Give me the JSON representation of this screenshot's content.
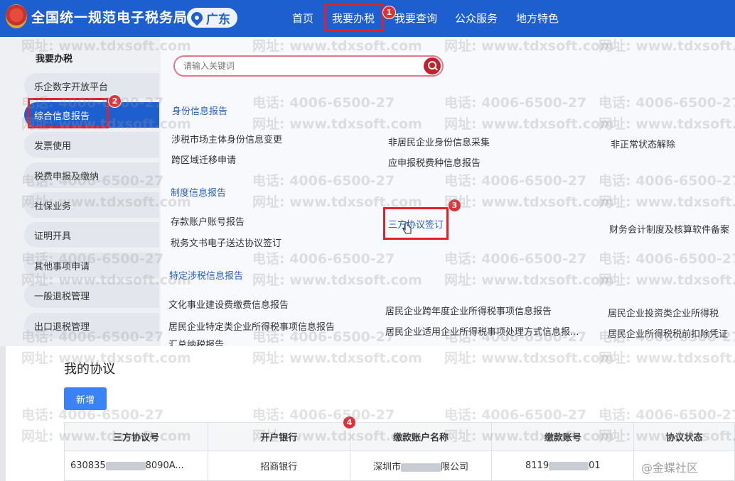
{
  "header": {
    "site_title": "全国统一规范电子税务局",
    "region": "广东",
    "nav": [
      "首页",
      "我要办税",
      "我要查询",
      "公众服务",
      "地方特色"
    ]
  },
  "sidebar": {
    "heading": "我要办税",
    "items": [
      "乐企数字开放平台",
      "综合信息报告",
      "发票使用",
      "税费申报及缴纳",
      "社保业务",
      "证明开具",
      "其他事项申请",
      "一般退税管理",
      "出口退税管理"
    ]
  },
  "search": {
    "placeholder": "请输入关键词"
  },
  "sections": {
    "identity": {
      "title": "身份信息报告",
      "links": [
        "涉税市场主体身份信息变更",
        "跨区域迁移申请",
        "非居民企业身份信息采集",
        "应申报税费种信息报告",
        "非正常状态解除"
      ]
    },
    "system": {
      "title": "制度信息报告",
      "links": [
        "存款账户账号报告",
        "税务文书电子送达协议签订",
        "三方协议签订",
        "财务会计制度及核算软件备案"
      ]
    },
    "specific": {
      "title": "特定涉税信息报告",
      "links": [
        "文化事业建设费缴费信息报告",
        "居民企业特定类企业所得税事项信息报告",
        "汇总纳税报告",
        "居民企业跨年度企业所得税事项信息报告",
        "居民企业适用企业所得税事项处理方式信息报...",
        "居民企业投资类企业所得税",
        "居民企业所得税税前扣除凭证"
      ]
    }
  },
  "markers": [
    "1",
    "2",
    "3",
    "4"
  ],
  "agreements": {
    "title": "我的协议",
    "add_label": "新增",
    "columns": [
      "三方协议号",
      "开户银行",
      "缴款账户名称",
      "缴款账号",
      "协议状态"
    ],
    "row": {
      "agreement_no_prefix": "630835",
      "agreement_no_suffix": "8090A...",
      "bank": "招商银行",
      "account_name_prefix": "深圳市",
      "account_name_suffix": "限公司",
      "account_no_prefix": "8119",
      "account_no_suffix": "01",
      "status": ""
    }
  },
  "watermarks": {
    "phone": "电话: 4006-6500-27",
    "site": "网址: www.tdxsoft.com"
  },
  "corner_mark": "@金蝶社区",
  "colors": {
    "nav_blue": "#1e5fd0",
    "annotation_red": "#e0202a",
    "link_blue": "#2b5fb8",
    "button_blue": "#3b82f6"
  }
}
